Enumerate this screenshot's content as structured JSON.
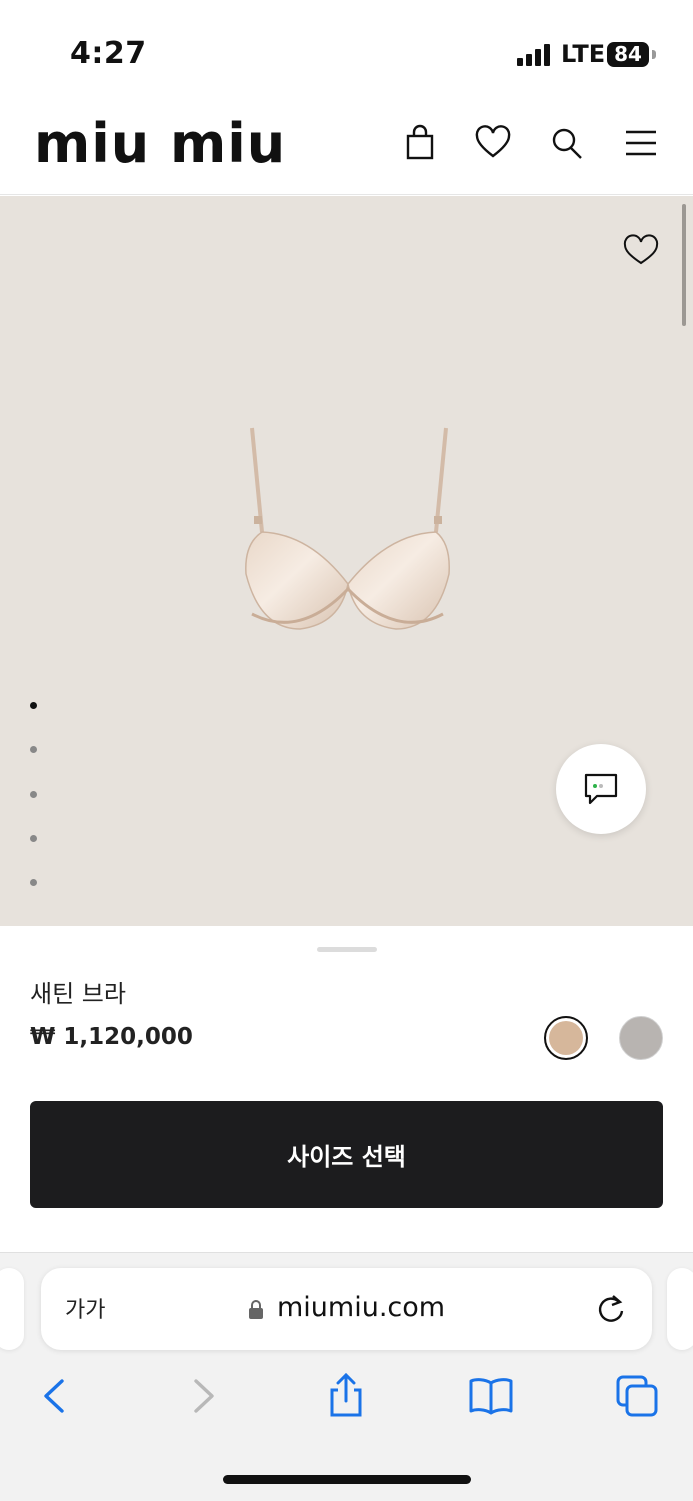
{
  "status_bar": {
    "time": "4:27",
    "network": "LTE",
    "battery": "84"
  },
  "header": {
    "logo": "miu miu"
  },
  "product": {
    "name": "새틴 브라",
    "price": "₩ 1,120,000",
    "swatch_colors": [
      "#d6b79b",
      "#b8b4b1"
    ],
    "selected_swatch": 0,
    "gallery_dots": 5,
    "active_dot": 0
  },
  "cta": {
    "label": "사이즈 선택"
  },
  "browser": {
    "text_size": "가가",
    "url": "miumiu.com"
  },
  "icons": [
    "bag-icon",
    "heart-icon",
    "search-icon",
    "menu-icon",
    "chat-icon",
    "lock-icon",
    "reload-icon",
    "back-icon",
    "forward-icon",
    "share-icon",
    "bookmarks-icon",
    "tabs-icon"
  ],
  "colors": {
    "gallery_bg": "#e7e2dc",
    "button_bg": "#1c1c1e",
    "safari_blue": "#1a73e8"
  }
}
